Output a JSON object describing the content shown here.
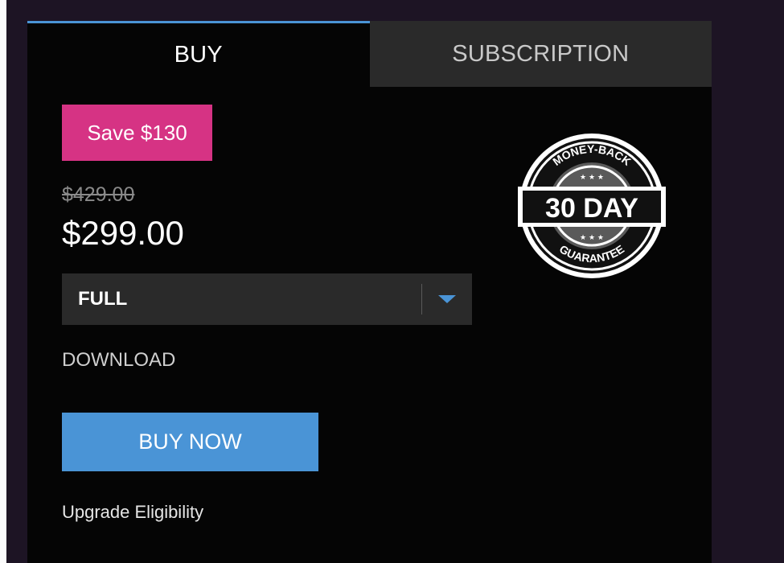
{
  "tabs": {
    "buy": "BUY",
    "subscription": "SUBSCRIPTION"
  },
  "offer": {
    "save_badge": "Save $130",
    "original_price": "$429.00",
    "current_price": "$299.00"
  },
  "edition_select": {
    "selected": "FULL"
  },
  "delivery": {
    "label": "DOWNLOAD"
  },
  "actions": {
    "buy_now": "BUY NOW",
    "upgrade_eligibility": "Upgrade Eligibility"
  },
  "guarantee_badge": {
    "top_text": "MONEY-BACK",
    "main_text": "30 DAY",
    "bottom_text": "GUARANTEE",
    "icon": "money-back-guarantee-icon"
  },
  "colors": {
    "accent_blue": "#4a94d6",
    "badge_pink": "#d63384",
    "panel_bg": "#050505",
    "page_bg": "#1d1424"
  }
}
